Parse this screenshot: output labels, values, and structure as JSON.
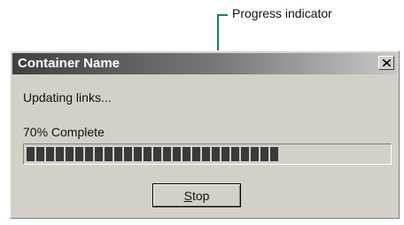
{
  "annotation": {
    "label": "Progress indicator",
    "line_color": "#1a7a7a"
  },
  "dialog": {
    "title": "Container Name",
    "close_glyph": "×",
    "status_text": "Updating links...",
    "progress": {
      "label": "70% Complete",
      "value_percent": 70,
      "fill_color": "#3a3a3a"
    },
    "stop_button": {
      "label_hotkey": "S",
      "label_rest": "top"
    }
  },
  "colors": {
    "dialog_background": "#d4d0c8",
    "title_bar_dark": "#404040"
  },
  "icons": {
    "close": "close-icon"
  }
}
